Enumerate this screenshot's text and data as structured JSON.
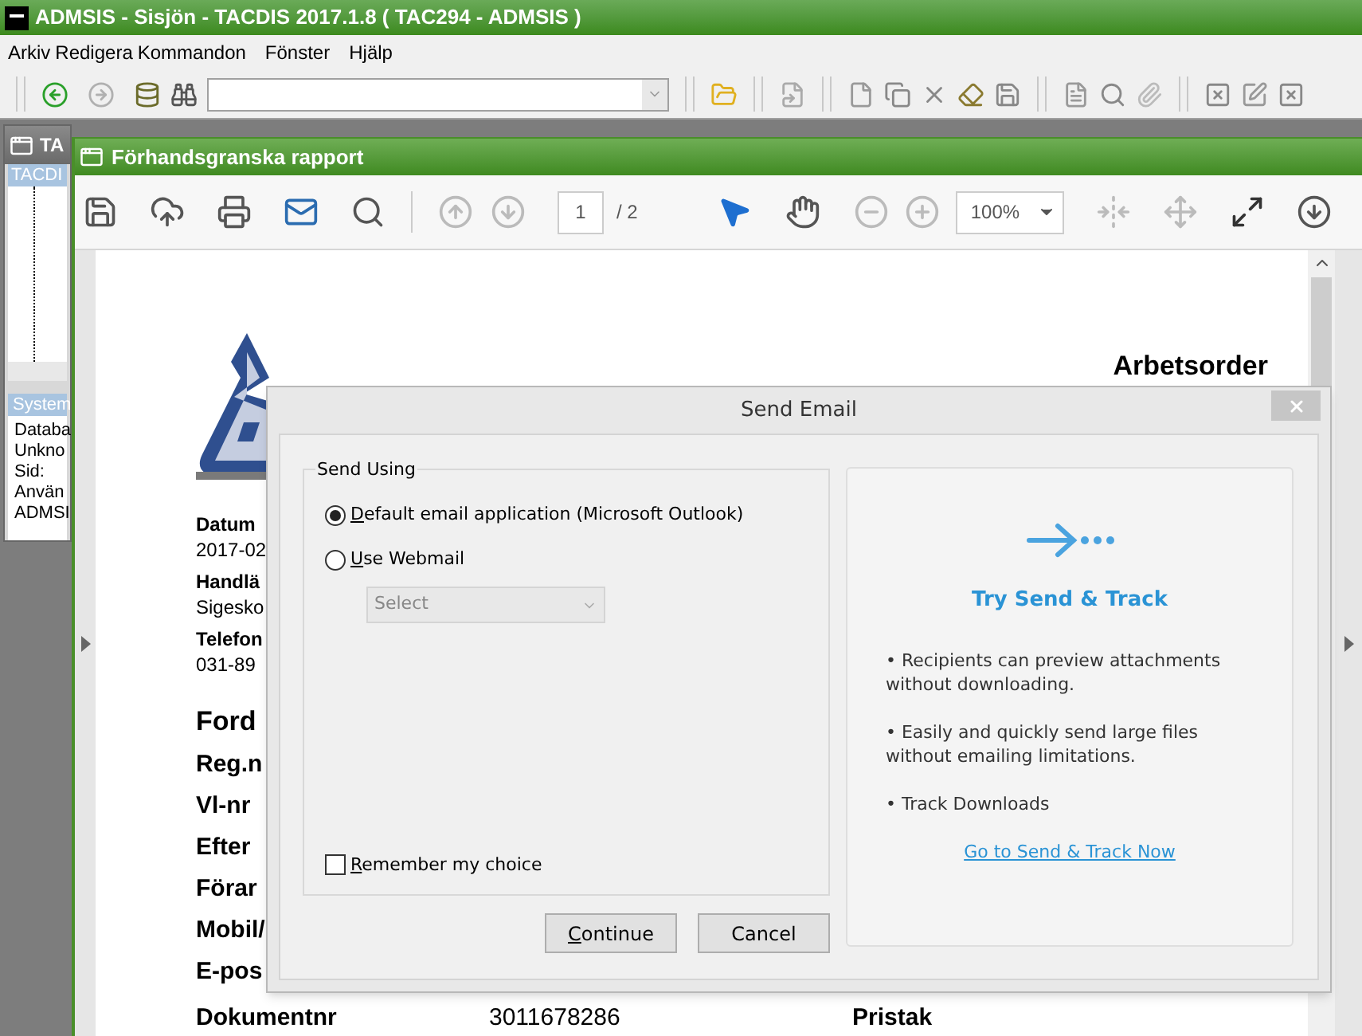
{
  "app": {
    "title": "ADMSIS - Sisjön - TACDIS 2017.1.8 ( TAC294 - ADMSIS )",
    "menu": [
      "Arkiv",
      "Redigera",
      "Kommandon",
      "Fönster",
      "Hjälp"
    ]
  },
  "back_window": {
    "title": "TA",
    "tree_header": "TACDI",
    "panel_header": "System",
    "lines": [
      "Databa",
      "Unkno",
      "Sid:",
      "Använ",
      "ADMSI"
    ]
  },
  "preview": {
    "title": "Förhandsgranska rapport",
    "page": "1",
    "page_total": "/ 2",
    "zoom": "100%"
  },
  "document": {
    "title": "Arbetsorder",
    "lines": [
      {
        "kind": "label",
        "text": "Datum"
      },
      {
        "kind": "value",
        "text": "2017-02"
      },
      {
        "kind": "label",
        "text": "Handlä"
      },
      {
        "kind": "value",
        "text": "Sigesko"
      },
      {
        "kind": "label",
        "text": "Telefon"
      },
      {
        "kind": "value",
        "text": "031-89"
      },
      {
        "kind": "section",
        "text": "Ford"
      },
      {
        "kind": "field",
        "text": "Reg.n"
      },
      {
        "kind": "field",
        "text": "Vl-nr"
      },
      {
        "kind": "field",
        "text": "Efter"
      },
      {
        "kind": "field",
        "text": "Förar"
      },
      {
        "kind": "field",
        "text": "Mobil/"
      },
      {
        "kind": "field",
        "text": "E-pos"
      }
    ],
    "bottom_row": [
      "Dokumentnr",
      "3011678286",
      "Pristak"
    ]
  },
  "dialog": {
    "title": "Send Email",
    "group_label": "Send Using",
    "options": [
      {
        "label": "Default email application (Microsoft Outlook)",
        "selected": true,
        "mnemonic": true
      },
      {
        "label": "Use Webmail",
        "selected": false,
        "mnemonic": true
      }
    ],
    "webmail_select": {
      "value": "Select",
      "disabled": true
    },
    "remember": {
      "label": "Remember my choice",
      "checked": false,
      "mnemonic": true
    },
    "buttons": [
      {
        "label": "Continue",
        "mnemonic": true
      },
      {
        "label": "Cancel",
        "mnemonic": false
      }
    ],
    "promo": {
      "title": "Try Send & Track",
      "bullets": [
        "• Recipients can preview attachments without downloading.",
        "• Easily and quickly send large files without emailing limitations.",
        "• Track Downloads"
      ],
      "link": "Go to Send & Track Now"
    }
  }
}
